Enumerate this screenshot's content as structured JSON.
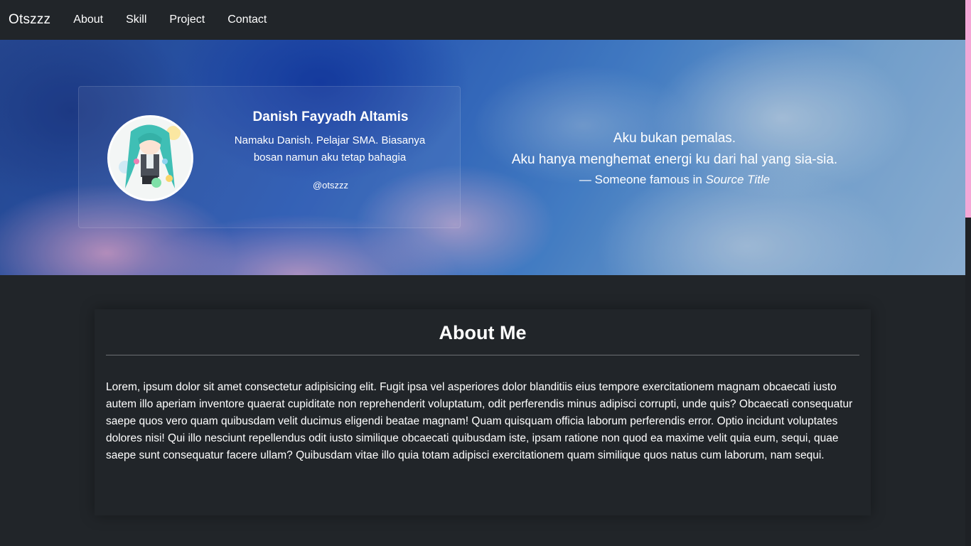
{
  "navbar": {
    "brand": "Otszzz",
    "links": [
      "About",
      "Skill",
      "Project",
      "Contact"
    ]
  },
  "profile": {
    "name": "Danish Fayyadh Altamis",
    "bio": "Namaku Danish. Pelajar SMA. Biasanya bosan namun aku tetap bahagia",
    "handle": "@otszzz"
  },
  "quote": {
    "line1": "Aku bukan pemalas.",
    "line2": "Aku hanya menghemat energi ku dari hal yang sia-sia.",
    "footer_prefix": "— Someone famous in",
    "source_title": "Source Title"
  },
  "about": {
    "title": "About Me",
    "text": "Lorem, ipsum dolor sit amet consectetur adipisicing elit. Fugit ipsa vel asperiores dolor blanditiis eius tempore exercitationem magnam obcaecati iusto autem illo aperiam inventore quaerat cupiditate non reprehenderit voluptatum, odit perferendis minus adipisci corrupti, unde quis? Obcaecati consequatur saepe quos vero quam quibusdam velit ducimus eligendi beatae magnam! Quam quisquam officia laborum perferendis error. Optio incidunt voluptates dolores nisi! Qui illo nesciunt repellendus odit iusto similique obcaecati quibusdam iste, ipsam ratione non quod ea maxime velit quia eum, sequi, quae saepe sunt consequatur facere ullam? Quibusdam vitae illo quia totam adipisci exercitationem quam similique quos natus cum laborum, nam sequi."
  },
  "colors": {
    "background": "#212529",
    "scrollbar_thumb": "#f4a7d6"
  }
}
